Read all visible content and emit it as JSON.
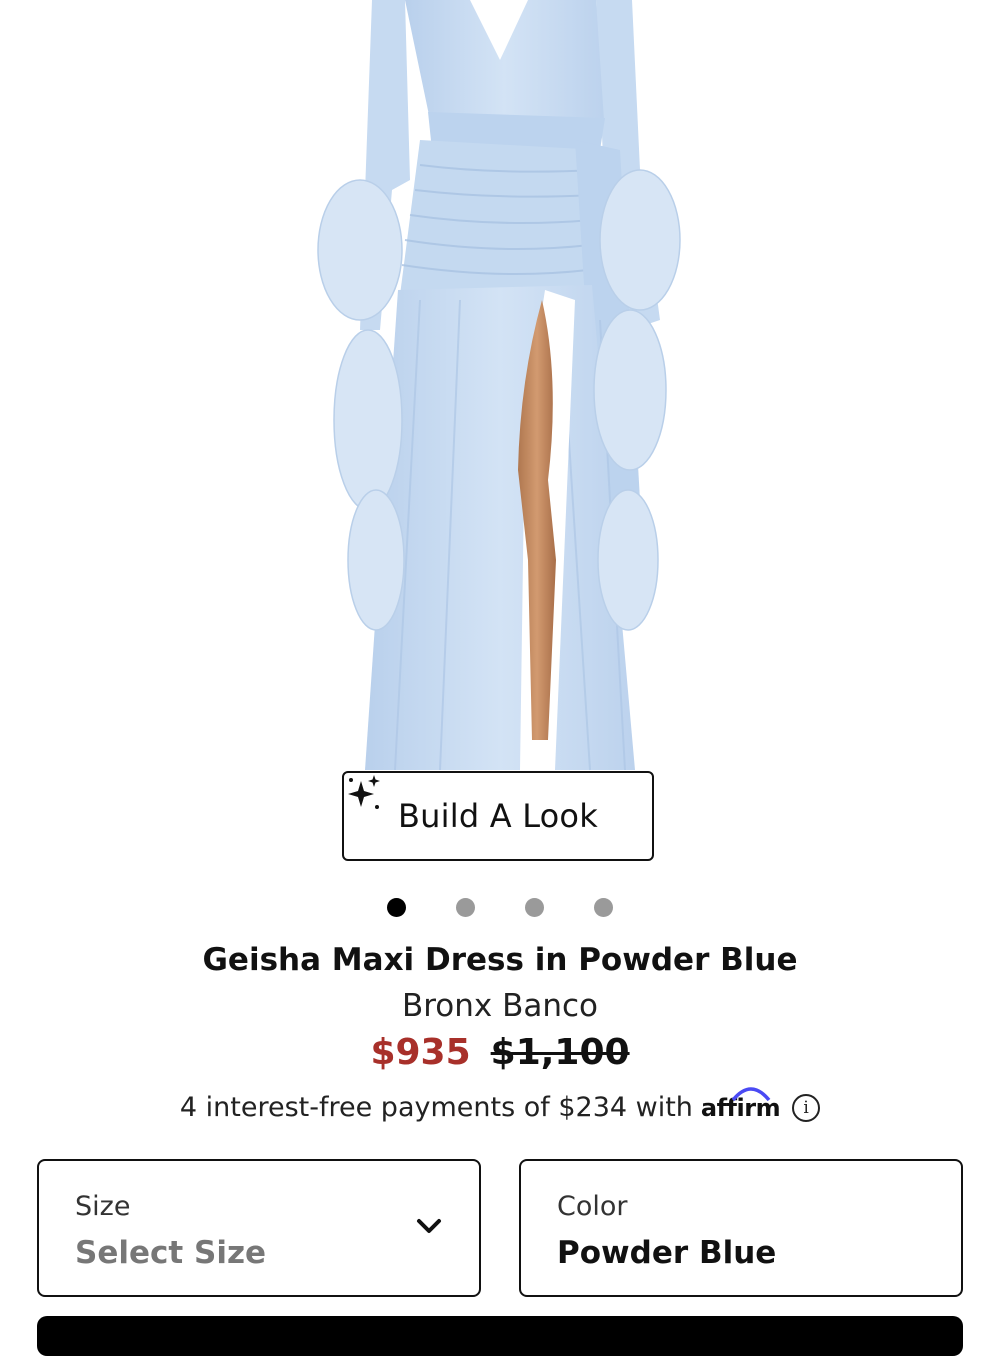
{
  "product_image": {
    "alt_icon": "dress-photo"
  },
  "build_look": {
    "label": "Build A Look",
    "icon": "sparkles-icon"
  },
  "carousel": {
    "count": 4,
    "active_index": 0
  },
  "product": {
    "title": "Geisha Maxi Dress in Powder Blue",
    "brand": "Bronx Banco",
    "sale_price": "$935",
    "original_price": "$1,100"
  },
  "financing": {
    "text": "4 interest-free payments of $234 with",
    "provider": "affirm",
    "info_icon": "ⓘ"
  },
  "size_selector": {
    "label": "Size",
    "value": "Select Size",
    "icon": "chevron-down-icon"
  },
  "color_selector": {
    "label": "Color",
    "value": "Powder Blue"
  },
  "colors": {
    "sale": "#a8302a",
    "dress": "#c8dcf2",
    "text": "#111111",
    "affirm_arc": "#4a4af4"
  }
}
